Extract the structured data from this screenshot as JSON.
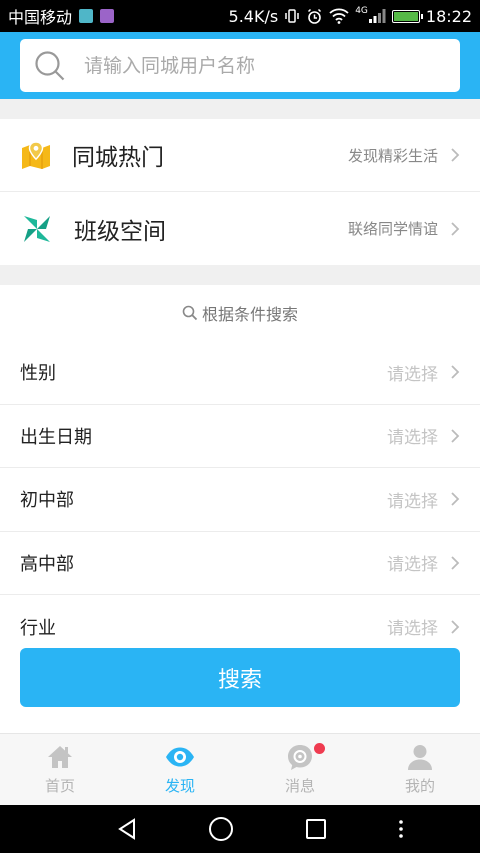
{
  "status_bar": {
    "carrier": "中国移动",
    "speed": "5.4K/s",
    "network": "4G",
    "time": "18:22"
  },
  "search": {
    "placeholder": "请输入同城用户名称"
  },
  "quick_links": [
    {
      "title": "同城热门",
      "hint": "发现精彩生活",
      "icon": "map-pin-icon"
    },
    {
      "title": "班级空间",
      "hint": "联络同学情谊",
      "icon": "pinwheel-icon"
    }
  ],
  "conditions": {
    "title": "根据条件搜索",
    "rows": [
      {
        "label": "性别",
        "value": "请选择"
      },
      {
        "label": "出生日期",
        "value": "请选择"
      },
      {
        "label": "初中部",
        "value": "请选择"
      },
      {
        "label": "高中部",
        "value": "请选择"
      },
      {
        "label": "行业",
        "value": "请选择"
      }
    ]
  },
  "search_button": "搜索",
  "tabs": [
    {
      "label": "首页",
      "icon": "home-icon"
    },
    {
      "label": "发现",
      "icon": "eye-icon",
      "active": true
    },
    {
      "label": "消息",
      "icon": "message-icon"
    },
    {
      "label": "我的",
      "icon": "profile-icon"
    }
  ],
  "colors": {
    "accent": "#2ab4f4",
    "badge": "#ef3b50"
  }
}
